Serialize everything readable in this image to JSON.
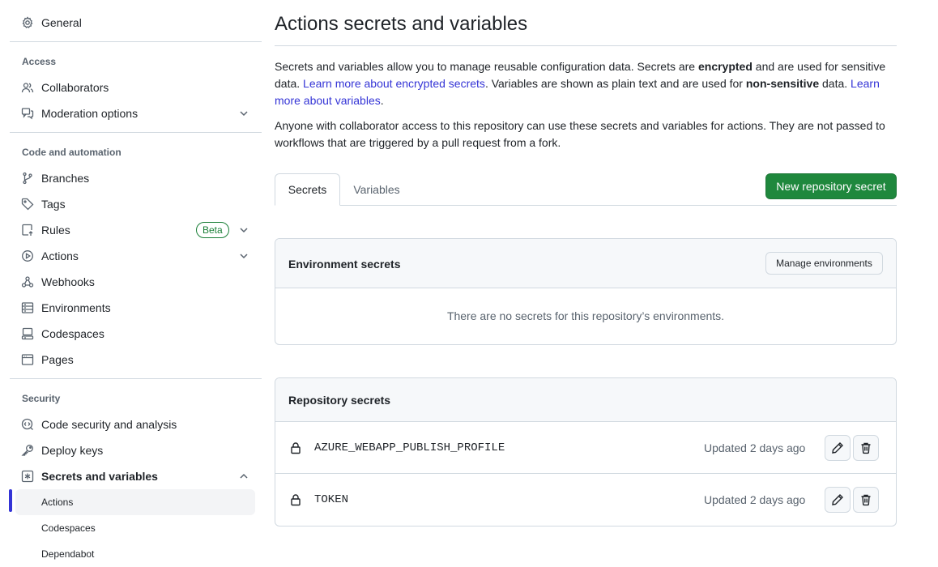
{
  "sidebar": {
    "general": "General",
    "sections": {
      "access": "Access",
      "code_automation": "Code and automation",
      "security": "Security"
    },
    "items": {
      "collaborators": "Collaborators",
      "moderation": "Moderation options",
      "branches": "Branches",
      "tags": "Tags",
      "rules": "Rules",
      "rules_badge": "Beta",
      "actions": "Actions",
      "webhooks": "Webhooks",
      "environments": "Environments",
      "codespaces": "Codespaces",
      "pages": "Pages",
      "code_security": "Code security and analysis",
      "deploy_keys": "Deploy keys",
      "secrets_variables": "Secrets and variables"
    },
    "sub_items": {
      "actions": "Actions",
      "codespaces": "Codespaces",
      "dependabot": "Dependabot"
    }
  },
  "main": {
    "title": "Actions secrets and variables",
    "desc1": {
      "p1": "Secrets and variables allow you to manage reusable configuration data. Secrets are ",
      "b1": "encrypted",
      "p2": " and are used for sensitive data. ",
      "link1": "Learn more about encrypted secrets",
      "p3": ". Variables are shown as plain text and are used for ",
      "b2": "non-sensitive",
      "p4": " data. ",
      "link2": "Learn more about variables",
      "p5": "."
    },
    "desc2": "Anyone with collaborator access to this repository can use these secrets and variables for actions. They are not passed to workflows that are triggered by a pull request from a fork.",
    "tabs": [
      "Secrets",
      "Variables"
    ],
    "new_secret_button": "New repository secret",
    "environment_secrets": {
      "heading": "Environment secrets",
      "manage_button": "Manage environments",
      "empty": "There are no secrets for this repository’s environments."
    },
    "repository_secrets": {
      "heading": "Repository secrets",
      "rows": [
        {
          "name": "AZURE_WEBAPP_PUBLISH_PROFILE",
          "updated": "Updated 2 days ago"
        },
        {
          "name": "TOKEN",
          "updated": "Updated 2 days ago"
        }
      ]
    }
  },
  "colors": {
    "accent": "#3434d6",
    "primary_button": "#1f883d",
    "badge": "#1a7f37",
    "border": "#d1d9e0",
    "muted_text": "#59636e"
  }
}
